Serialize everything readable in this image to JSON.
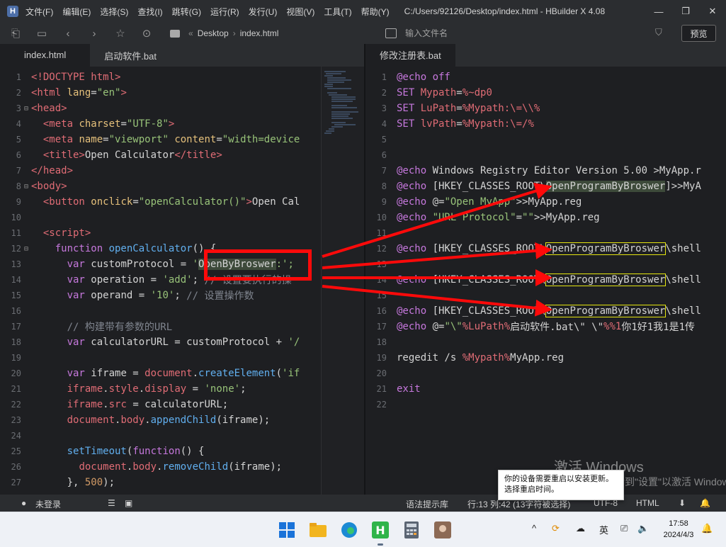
{
  "window": {
    "title": "C:/Users/92126/Desktop/index.html - HBuilder X 4.08",
    "logo": "H",
    "menu": [
      "文件(F)",
      "编辑(E)",
      "选择(S)",
      "查找(I)",
      "跳转(G)",
      "运行(R)",
      "发行(U)",
      "视图(V)",
      "工具(T)",
      "帮助(Y)"
    ]
  },
  "toolbar": {
    "breadcrumb_folder": "Desktop",
    "breadcrumb_file": "index.html",
    "search_placeholder": "输入文件名",
    "preview_label": "预览"
  },
  "tabs_left": [
    {
      "label": "index.html",
      "active": true
    },
    {
      "label": "启动软件.bat",
      "active": false
    }
  ],
  "tabs_right": [
    {
      "label": "修改注册表.bat",
      "active": true
    }
  ],
  "left_code": [
    {
      "n": "1",
      "fold": "",
      "segs": [
        [
          "t-tag",
          "<!DOCTYPE html>"
        ]
      ]
    },
    {
      "n": "2",
      "fold": "",
      "segs": [
        [
          "t-tag",
          "<html "
        ],
        [
          "t-attr",
          "lang"
        ],
        [
          "code",
          "="
        ],
        [
          "t-str",
          "\"en\""
        ],
        [
          "t-tag",
          ">"
        ]
      ]
    },
    {
      "n": "3",
      "fold": "⊟",
      "segs": [
        [
          "t-tag",
          "<head>"
        ]
      ]
    },
    {
      "n": "4",
      "fold": "",
      "segs": [
        [
          "code",
          "  "
        ],
        [
          "t-tag",
          "<meta "
        ],
        [
          "t-attr",
          "charset"
        ],
        [
          "code",
          "="
        ],
        [
          "t-str",
          "\"UTF-8\""
        ],
        [
          "t-tag",
          ">"
        ]
      ]
    },
    {
      "n": "5",
      "fold": "",
      "segs": [
        [
          "code",
          "  "
        ],
        [
          "t-tag",
          "<meta "
        ],
        [
          "t-attr",
          "name"
        ],
        [
          "code",
          "="
        ],
        [
          "t-str",
          "\"viewport\""
        ],
        [
          "code",
          " "
        ],
        [
          "t-attr",
          "content"
        ],
        [
          "code",
          "="
        ],
        [
          "t-str",
          "\"width=device"
        ]
      ]
    },
    {
      "n": "6",
      "fold": "",
      "segs": [
        [
          "code",
          "  "
        ],
        [
          "t-tag",
          "<title>"
        ],
        [
          "code",
          "Open Calculator"
        ],
        [
          "t-tag",
          "</title>"
        ]
      ]
    },
    {
      "n": "7",
      "fold": "",
      "segs": [
        [
          "t-tag",
          "</head>"
        ]
      ]
    },
    {
      "n": "8",
      "fold": "⊟",
      "segs": [
        [
          "t-tag",
          "<body>"
        ]
      ]
    },
    {
      "n": "9",
      "fold": "",
      "segs": [
        [
          "code",
          "  "
        ],
        [
          "t-tag",
          "<button "
        ],
        [
          "t-attr",
          "onclick"
        ],
        [
          "code",
          "="
        ],
        [
          "t-str",
          "\"openCalculator()\""
        ],
        [
          "t-tag",
          ">"
        ],
        [
          "code",
          "Open Cal"
        ]
      ]
    },
    {
      "n": "10",
      "fold": "",
      "segs": [
        [
          "code",
          ""
        ]
      ]
    },
    {
      "n": "11",
      "fold": "",
      "segs": [
        [
          "code",
          "  "
        ],
        [
          "t-tag",
          "<script>"
        ]
      ]
    },
    {
      "n": "12",
      "fold": "⊟",
      "segs": [
        [
          "code",
          "    "
        ],
        [
          "t-kw",
          "function "
        ],
        [
          "t-fn",
          "openCalculator"
        ],
        [
          "code",
          "() {"
        ]
      ]
    },
    {
      "n": "13",
      "fold": "",
      "segs": [
        [
          "code",
          "      "
        ],
        [
          "t-kw",
          "var "
        ],
        [
          "code",
          "customProtocol = "
        ],
        [
          "t-str",
          "'"
        ],
        [
          "hl",
          "OpenByBroswer"
        ],
        [
          "t-str",
          ":';"
        ]
      ]
    },
    {
      "n": "14",
      "fold": "",
      "segs": [
        [
          "code",
          "      "
        ],
        [
          "t-kw",
          "var "
        ],
        [
          "code",
          "operation = "
        ],
        [
          "t-str",
          "'add'"
        ],
        [
          "code",
          "; "
        ],
        [
          "t-cm",
          "// 设置要执行的操"
        ]
      ]
    },
    {
      "n": "15",
      "fold": "",
      "segs": [
        [
          "code",
          "      "
        ],
        [
          "t-kw",
          "var "
        ],
        [
          "code",
          "operand = "
        ],
        [
          "t-str",
          "'10'"
        ],
        [
          "code",
          "; "
        ],
        [
          "t-cm",
          "// 设置操作数"
        ]
      ]
    },
    {
      "n": "16",
      "fold": "",
      "segs": [
        [
          "code",
          ""
        ]
      ]
    },
    {
      "n": "17",
      "fold": "",
      "segs": [
        [
          "code",
          "      "
        ],
        [
          "t-cm",
          "// 构建带有参数的URL"
        ]
      ]
    },
    {
      "n": "18",
      "fold": "",
      "segs": [
        [
          "code",
          "      "
        ],
        [
          "t-kw",
          "var "
        ],
        [
          "code",
          "calculatorURL = customProtocol + "
        ],
        [
          "t-str",
          "'/"
        ]
      ]
    },
    {
      "n": "19",
      "fold": "",
      "segs": [
        [
          "code",
          ""
        ]
      ]
    },
    {
      "n": "20",
      "fold": "",
      "segs": [
        [
          "code",
          "      "
        ],
        [
          "t-kw",
          "var "
        ],
        [
          "code",
          "iframe = "
        ],
        [
          "t-var",
          "document"
        ],
        [
          "code",
          "."
        ],
        [
          "t-fn",
          "createElement"
        ],
        [
          "code",
          "("
        ],
        [
          "t-str",
          "'if"
        ]
      ]
    },
    {
      "n": "21",
      "fold": "",
      "segs": [
        [
          "code",
          "      "
        ],
        [
          "t-var",
          "iframe"
        ],
        [
          "code",
          "."
        ],
        [
          "t-var",
          "style"
        ],
        [
          "code",
          "."
        ],
        [
          "t-var",
          "display"
        ],
        [
          "code",
          " = "
        ],
        [
          "t-str",
          "'none'"
        ],
        [
          "code",
          ";"
        ]
      ]
    },
    {
      "n": "22",
      "fold": "",
      "segs": [
        [
          "code",
          "      "
        ],
        [
          "t-var",
          "iframe"
        ],
        [
          "code",
          "."
        ],
        [
          "t-var",
          "src"
        ],
        [
          "code",
          " = calculatorURL;"
        ]
      ]
    },
    {
      "n": "23",
      "fold": "",
      "segs": [
        [
          "code",
          "      "
        ],
        [
          "t-var",
          "document"
        ],
        [
          "code",
          "."
        ],
        [
          "t-var",
          "body"
        ],
        [
          "code",
          "."
        ],
        [
          "t-fn",
          "appendChild"
        ],
        [
          "code",
          "(iframe);"
        ]
      ]
    },
    {
      "n": "24",
      "fold": "",
      "segs": [
        [
          "code",
          ""
        ]
      ]
    },
    {
      "n": "25",
      "fold": "",
      "segs": [
        [
          "code",
          "      "
        ],
        [
          "t-fn",
          "setTimeout"
        ],
        [
          "code",
          "("
        ],
        [
          "t-kw",
          "function"
        ],
        [
          "code",
          "() {"
        ]
      ]
    },
    {
      "n": "26",
      "fold": "",
      "segs": [
        [
          "code",
          "        "
        ],
        [
          "t-var",
          "document"
        ],
        [
          "code",
          "."
        ],
        [
          "t-var",
          "body"
        ],
        [
          "code",
          "."
        ],
        [
          "t-fn",
          "removeChild"
        ],
        [
          "code",
          "(iframe);"
        ]
      ]
    },
    {
      "n": "27",
      "fold": "",
      "segs": [
        [
          "code",
          "      }, "
        ],
        [
          "t-num",
          "500"
        ],
        [
          "code",
          ");"
        ]
      ]
    }
  ],
  "right_code": [
    {
      "n": "1",
      "segs": [
        [
          "t-echo",
          "@echo "
        ],
        [
          "t-kw",
          "off"
        ]
      ]
    },
    {
      "n": "2",
      "segs": [
        [
          "t-kw",
          "SET "
        ],
        [
          "t-var",
          "Mypath"
        ],
        [
          "code",
          "="
        ],
        [
          "t-var",
          "%~dp0"
        ]
      ]
    },
    {
      "n": "3",
      "segs": [
        [
          "t-kw",
          "SET "
        ],
        [
          "t-var",
          "LuPath"
        ],
        [
          "code",
          "="
        ],
        [
          "t-var",
          "%Mypath:\\=\\\\%"
        ]
      ]
    },
    {
      "n": "4",
      "segs": [
        [
          "t-kw",
          "SET "
        ],
        [
          "t-var",
          "lvPath"
        ],
        [
          "code",
          "="
        ],
        [
          "t-var",
          "%Mypath:\\=/%"
        ]
      ]
    },
    {
      "n": "5",
      "segs": [
        [
          "code",
          ""
        ]
      ]
    },
    {
      "n": "6",
      "segs": [
        [
          "code",
          ""
        ]
      ]
    },
    {
      "n": "7",
      "segs": [
        [
          "t-echo",
          "@echo "
        ],
        [
          "code",
          "Windows Registry Editor Version 5.00 >MyApp.r"
        ]
      ]
    },
    {
      "n": "8",
      "segs": [
        [
          "t-echo",
          "@echo "
        ],
        [
          "code",
          "[HKEY_CLASSES_ROOT\\"
        ],
        [
          "hl",
          "OpenProgramByBroswer"
        ],
        [
          "code",
          "]>>MyA"
        ]
      ]
    },
    {
      "n": "9",
      "segs": [
        [
          "t-echo",
          "@echo "
        ],
        [
          "code",
          "@="
        ],
        [
          "t-str",
          "\"Open MyApp\""
        ],
        [
          "code",
          ">>MyApp.reg"
        ]
      ]
    },
    {
      "n": "10",
      "segs": [
        [
          "t-echo",
          "@echo "
        ],
        [
          "t-str",
          "\"URL Protocol\""
        ],
        [
          "code",
          "="
        ],
        [
          "t-str",
          "\"\""
        ],
        [
          "code",
          ">>MyApp.reg"
        ]
      ]
    },
    {
      "n": "11",
      "segs": [
        [
          "code",
          ""
        ]
      ]
    },
    {
      "n": "12",
      "segs": [
        [
          "t-echo",
          "@echo "
        ],
        [
          "code",
          "[HKEY_CLASSES_ROOT\\"
        ],
        [
          "box",
          "OpenProgramByBroswer"
        ],
        [
          "code",
          "\\shell"
        ]
      ]
    },
    {
      "n": "13",
      "segs": [
        [
          "code",
          ""
        ]
      ]
    },
    {
      "n": "14",
      "segs": [
        [
          "t-echo",
          "@echo "
        ],
        [
          "code",
          "[HKEY_CLASSES_ROOT\\"
        ],
        [
          "box",
          "OpenProgramByBroswer"
        ],
        [
          "code",
          "\\shell"
        ]
      ]
    },
    {
      "n": "15",
      "segs": [
        [
          "code",
          ""
        ]
      ]
    },
    {
      "n": "16",
      "segs": [
        [
          "t-echo",
          "@echo "
        ],
        [
          "code",
          "[HKEY_CLASSES_ROOT\\"
        ],
        [
          "box",
          "OpenProgramByBroswer"
        ],
        [
          "code",
          "\\shell"
        ]
      ]
    },
    {
      "n": "17",
      "segs": [
        [
          "t-echo",
          "@echo "
        ],
        [
          "code",
          "@="
        ],
        [
          "t-str",
          "\"\\\""
        ],
        [
          "t-var",
          "%LuPath%"
        ],
        [
          "code",
          "启动软件.bat\\\" \\\""
        ],
        [
          "t-var",
          "%%1"
        ],
        [
          "code",
          "你1好1我1是1传"
        ]
      ]
    },
    {
      "n": "18",
      "segs": [
        [
          "code",
          ""
        ]
      ]
    },
    {
      "n": "19",
      "segs": [
        [
          "code",
          "regedit /s "
        ],
        [
          "t-var",
          "%Mypath%"
        ],
        [
          "code",
          "MyApp.reg"
        ]
      ]
    },
    {
      "n": "20",
      "segs": [
        [
          "code",
          ""
        ]
      ]
    },
    {
      "n": "21",
      "segs": [
        [
          "t-kw",
          "exit"
        ]
      ]
    },
    {
      "n": "22",
      "segs": [
        [
          "code",
          ""
        ]
      ]
    }
  ],
  "statusbar": {
    "login": "未登录",
    "syntax_hint": "语法提示库",
    "cursor": "行:13   列:42 (13字符被选择)",
    "encoding": "UTF-8",
    "language": "HTML"
  },
  "notification": {
    "line1": "你的设备需要重启以安装更新。",
    "line2": "选择重启时间。"
  },
  "watermark": {
    "line1": "激活 Windows",
    "line2": "转到\"设置\"以激活 Windows。"
  },
  "taskbar": {
    "ime": "英",
    "time": "17:58",
    "date": "2024/4/3"
  },
  "colors": {
    "annotation_red": "#ff0a0a",
    "editor_bg": "#1e1f22",
    "chrome_bg": "#2b2d30"
  }
}
